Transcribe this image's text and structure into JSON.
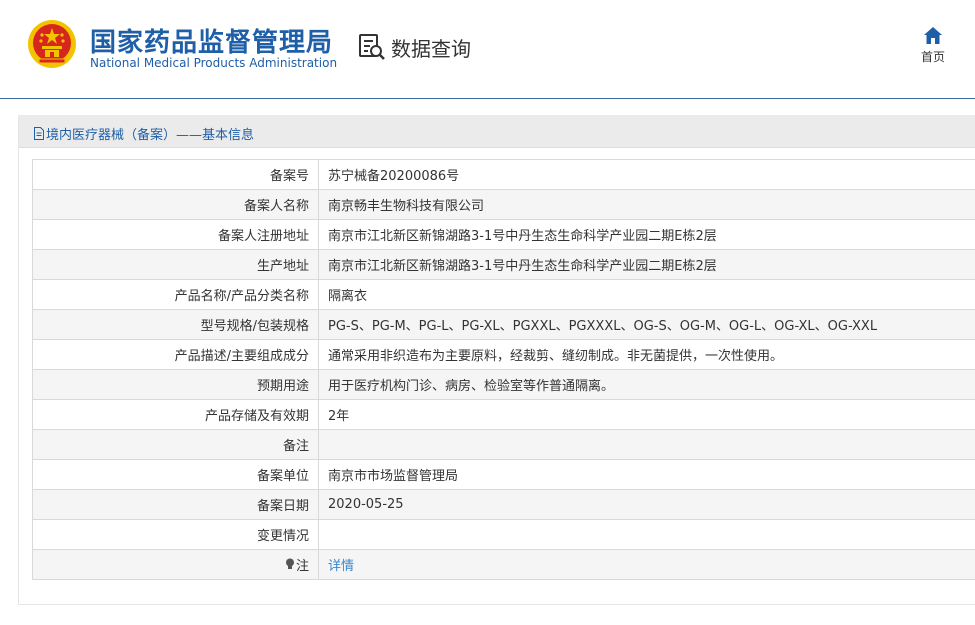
{
  "header": {
    "title_cn": "国家药品监督管理局",
    "title_en": "National Medical Products Administration",
    "query_label": "数据查询",
    "home_label": "首页"
  },
  "panel": {
    "title": "境内医疗器械（备案）——基本信息"
  },
  "rows": [
    {
      "label": "备案号",
      "value": "苏宁械备20200086号"
    },
    {
      "label": "备案人名称",
      "value": "南京畅丰生物科技有限公司"
    },
    {
      "label": "备案人注册地址",
      "value": "南京市江北新区新锦湖路3-1号中丹生态生命科学产业园二期E栋2层"
    },
    {
      "label": "生产地址",
      "value": "南京市江北新区新锦湖路3-1号中丹生态生命科学产业园二期E栋2层"
    },
    {
      "label": "产品名称/产品分类名称",
      "value": "隔离衣"
    },
    {
      "label": "型号规格/包装规格",
      "value": "PG-S、PG-M、PG-L、PG-XL、PGXXL、PGXXXL、OG-S、OG-M、OG-L、OG-XL、OG-XXL"
    },
    {
      "label": "产品描述/主要组成成分",
      "value": "通常采用非织造布为主要原料，经裁剪、缝纫制成。非无菌提供，一次性使用。"
    },
    {
      "label": "预期用途",
      "value": "用于医疗机构门诊、病房、检验室等作普通隔离。"
    },
    {
      "label": "产品存储及有效期",
      "value": "2年"
    },
    {
      "label": "备注",
      "value": ""
    },
    {
      "label": "备案单位",
      "value": "南京市市场监督管理局"
    },
    {
      "label": "备案日期",
      "value": "2020-05-25"
    },
    {
      "label": "变更情况",
      "value": ""
    }
  ],
  "note_row": {
    "label": "注",
    "link": "详情"
  },
  "icons": {
    "emblem": "national-emblem-icon",
    "query": "search-document-icon",
    "home": "home-icon",
    "doc": "document-icon",
    "note": "lightbulb-icon"
  },
  "colors": {
    "brand_blue": "#1f5fa8",
    "header_line": "#3a6fa0",
    "link_blue": "#3a87c8",
    "panel_head_bg": "#ebebeb",
    "row_alt_bg": "#f5f5f5",
    "emblem_red": "#d7261e",
    "emblem_gold": "#f3c300"
  }
}
